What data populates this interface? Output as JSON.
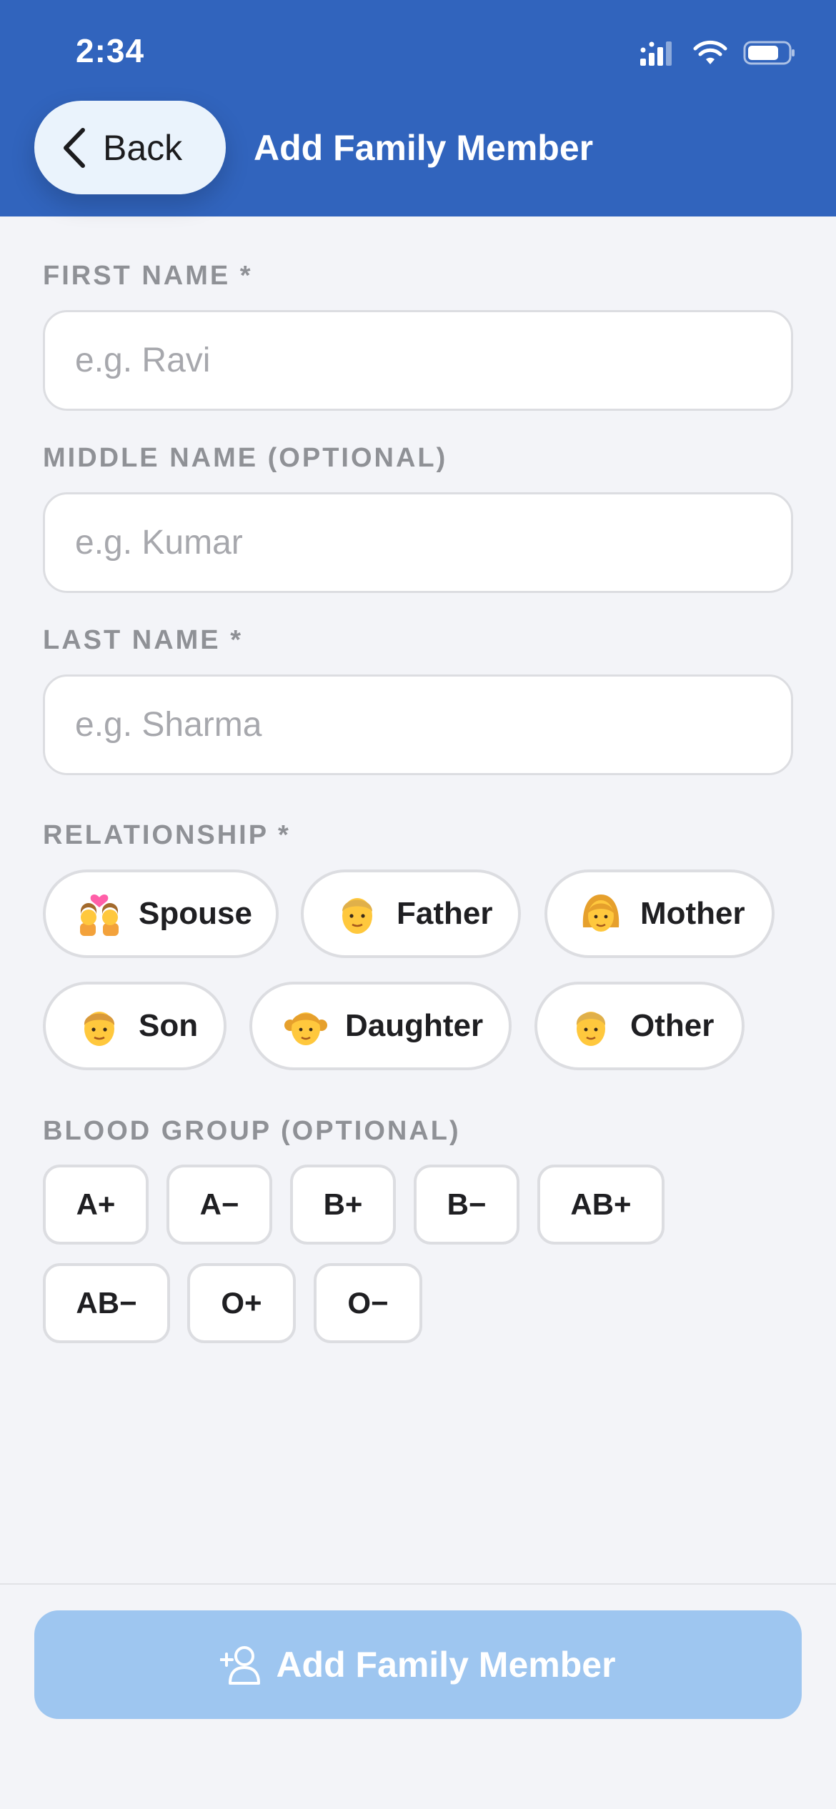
{
  "status_bar": {
    "time": "2:34"
  },
  "header": {
    "back_label": "Back",
    "title": "Add Family Member"
  },
  "form": {
    "first_name": {
      "label": "FIRST NAME *",
      "placeholder": "e.g. Ravi",
      "value": ""
    },
    "middle_name": {
      "label": "MIDDLE NAME (OPTIONAL)",
      "placeholder": "e.g. Kumar",
      "value": ""
    },
    "last_name": {
      "label": "LAST NAME *",
      "placeholder": "e.g. Sharma",
      "value": ""
    },
    "relationship": {
      "label": "RELATIONSHIP *",
      "options": [
        {
          "label": "Spouse",
          "icon": "couple-emoji-icon"
        },
        {
          "label": "Father",
          "icon": "man-emoji-icon"
        },
        {
          "label": "Mother",
          "icon": "woman-emoji-icon"
        },
        {
          "label": "Son",
          "icon": "boy-emoji-icon"
        },
        {
          "label": "Daughter",
          "icon": "girl-emoji-icon"
        },
        {
          "label": "Other",
          "icon": "person-emoji-icon"
        }
      ]
    },
    "blood_group": {
      "label": "BLOOD GROUP (OPTIONAL)",
      "options": [
        "A+",
        "A−",
        "B+",
        "B−",
        "AB+",
        "AB−",
        "O+",
        "O−"
      ]
    }
  },
  "footer": {
    "submit_label": "Add Family Member",
    "submit_icon": "add-person-icon",
    "submit_enabled": false
  },
  "colors": {
    "header": "#3164bd",
    "back_button": "#eaf3fc",
    "submit_disabled": "#9ec6f0",
    "background": "#f3f4f8"
  }
}
